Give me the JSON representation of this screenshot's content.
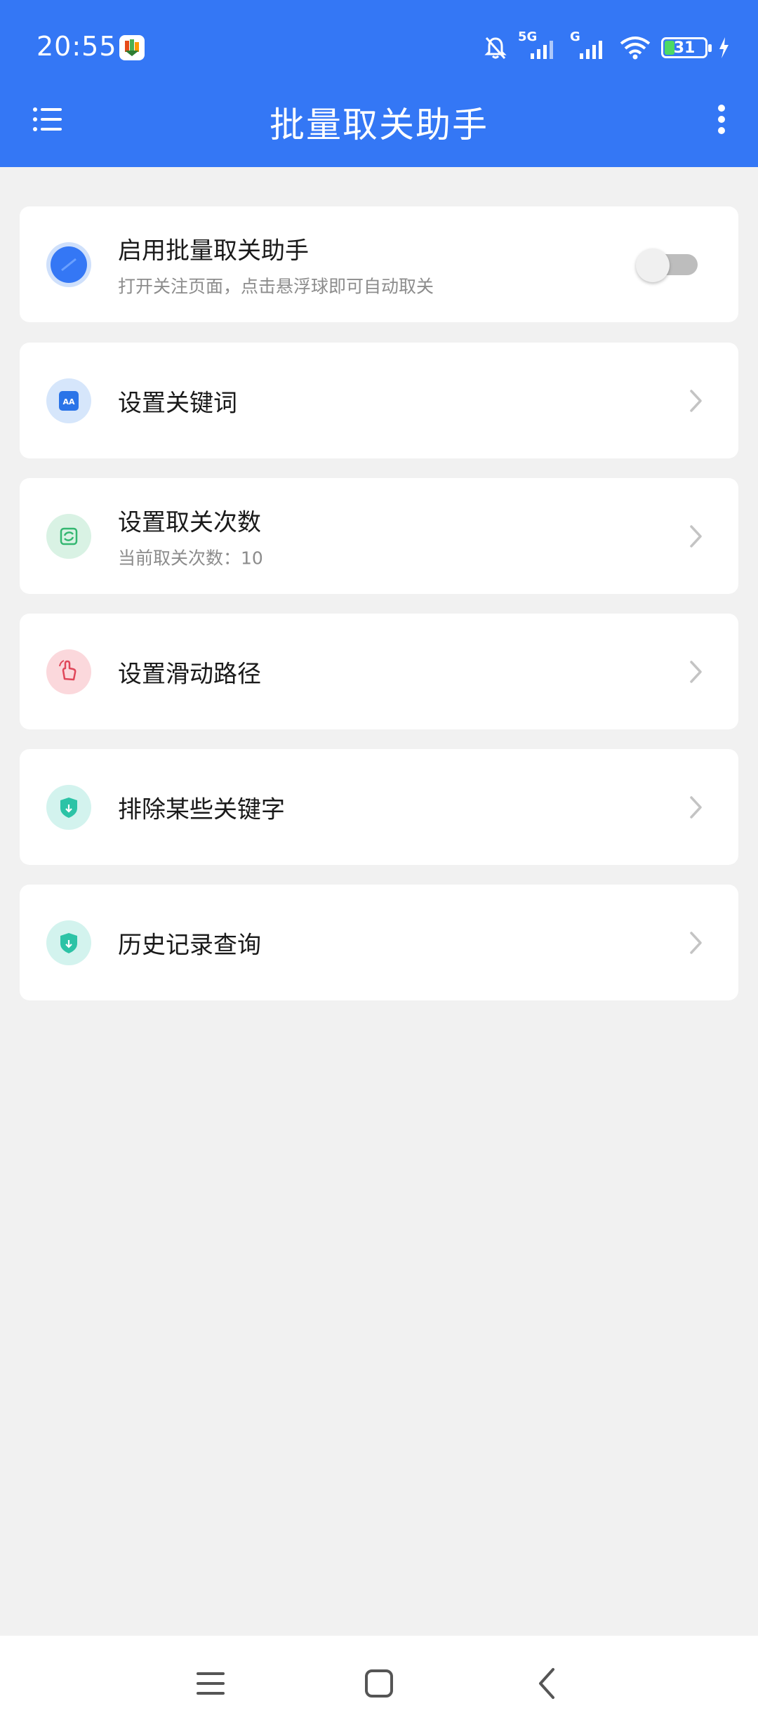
{
  "status": {
    "time": "20:55",
    "network1": "5G",
    "network2": "G",
    "battery": "31"
  },
  "appbar": {
    "title": "批量取关助手"
  },
  "items": [
    {
      "title": "启用批量取关助手",
      "subtitle": "打开关注页面，点击悬浮球即可自动取关",
      "toggle_on": false
    },
    {
      "title": "设置关键词",
      "subtitle": ""
    },
    {
      "title": "设置取关次数",
      "subtitle": "当前取关次数：10"
    },
    {
      "title": "设置滑动路径",
      "subtitle": ""
    },
    {
      "title": "排除某些关键字",
      "subtitle": ""
    },
    {
      "title": "历史记录查询",
      "subtitle": ""
    }
  ],
  "colors": {
    "primary": "#3477f5",
    "background": "#f1f1f1"
  }
}
